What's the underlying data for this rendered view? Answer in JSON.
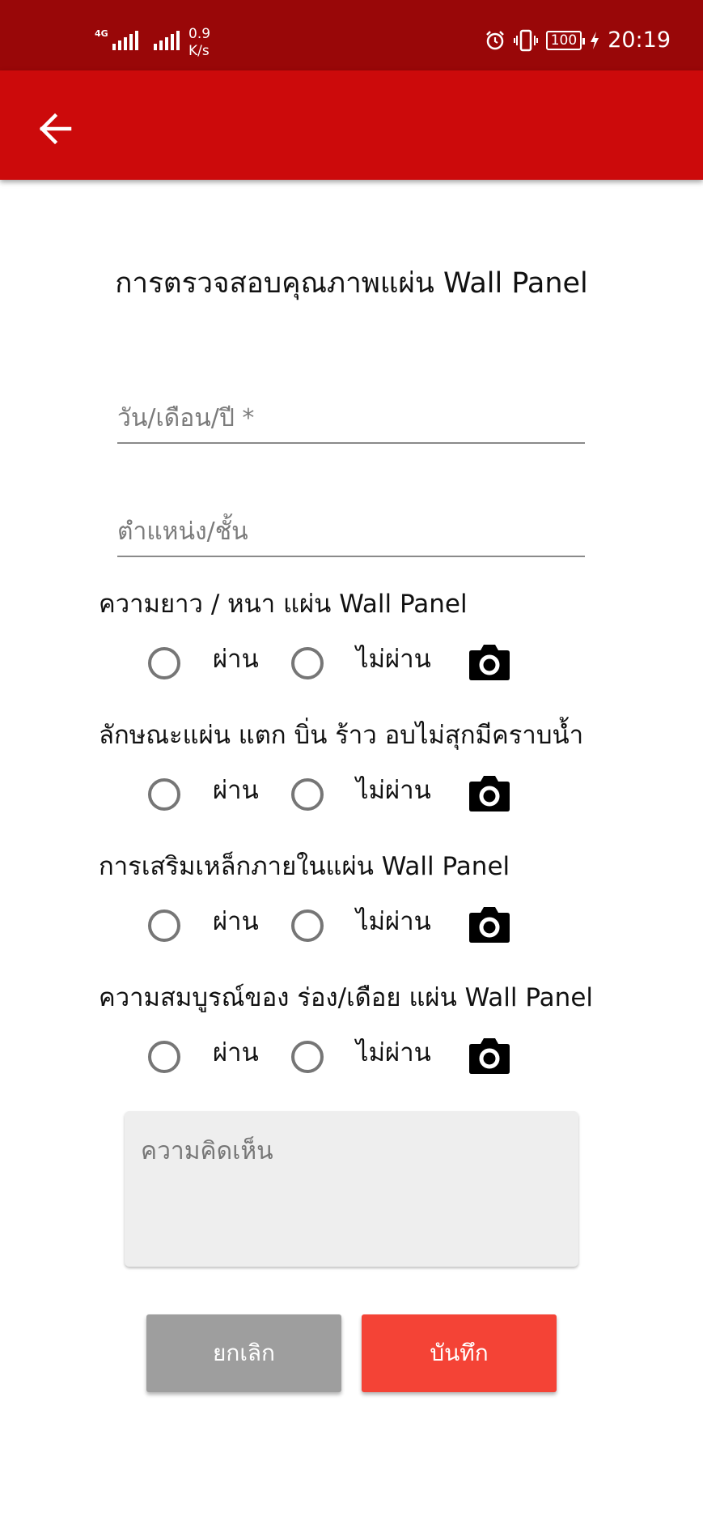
{
  "status_bar": {
    "network": "4G",
    "speed_value": "0.9",
    "speed_unit": "K/s",
    "battery": "100",
    "time": "20:19"
  },
  "app_bar": {
    "back_icon": "arrow-left-icon"
  },
  "form": {
    "title": "การตรวจสอบคุณภาพแผ่น Wall Panel",
    "date_placeholder": "วัน/เดือน/ปี *",
    "position_placeholder": "ตำแหน่ง/ชั้น",
    "pass_label": "ผ่าน",
    "fail_label": "ไม่ผ่าน",
    "questions": [
      {
        "label": "ความยาว / หนา แผ่น Wall Panel"
      },
      {
        "label": "ลักษณะแผ่น แตก บิ่น ร้าว อบไม่สุกมีคราบน้ำ"
      },
      {
        "label": "การเสริมเหล็กภายในแผ่น Wall Panel"
      },
      {
        "label": "ความสมบูรณ์ของ ร่อง/เดือย แผ่น Wall Panel"
      }
    ],
    "comment_placeholder": "ความคิดเห็น"
  },
  "buttons": {
    "cancel": "ยกเลิก",
    "save": "บันทึก"
  },
  "colors": {
    "status_bar": "#990708",
    "app_bar": "#cc0a0b",
    "save_button": "#f44336",
    "cancel_button": "#9e9e9e"
  }
}
